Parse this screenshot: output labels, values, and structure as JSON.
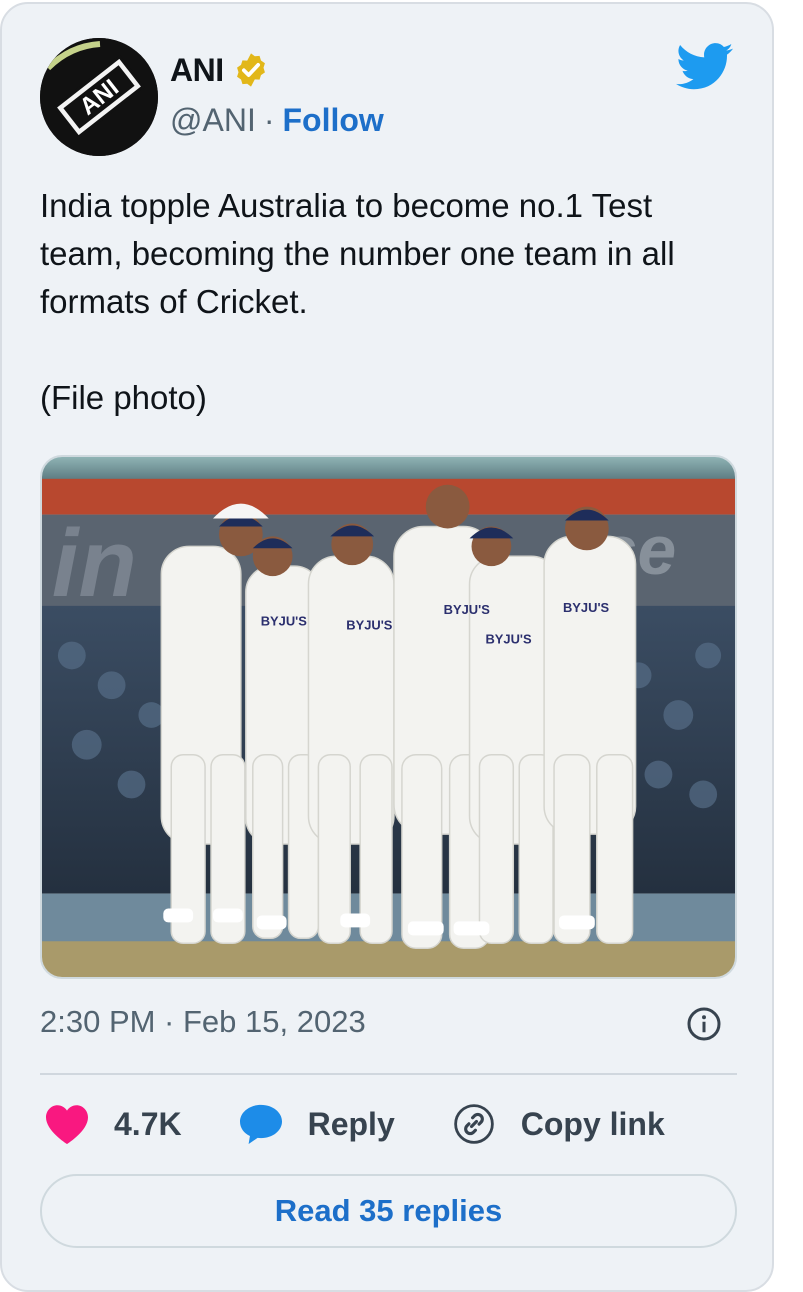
{
  "author": {
    "display_name": "ANI",
    "handle": "@ANI",
    "separator": "·",
    "follow_label": "Follow",
    "avatar_logo_text": "ANI",
    "verified_icon": "verified-badge-icon",
    "platform_icon": "twitter-bird-icon"
  },
  "tweet": {
    "text": "India topple Australia to become no.1 Test team, becoming the number one team in all formats of Cricket.\n\n(File photo)",
    "photo_icon": "cricket-team-photo",
    "photo_banner_text": "BYJU'S",
    "timestamp": "2:30 PM · Feb 15, 2023",
    "info_icon": "info-icon"
  },
  "actions": {
    "like_count": "4.7K",
    "reply_label": "Reply",
    "copy_label": "Copy link"
  },
  "read_replies_label": "Read 35 replies",
  "colors": {
    "accent": "#1d6fc9",
    "like": "#f91880",
    "twitter_blue": "#1d9bf0",
    "verified": "#e2b719"
  }
}
